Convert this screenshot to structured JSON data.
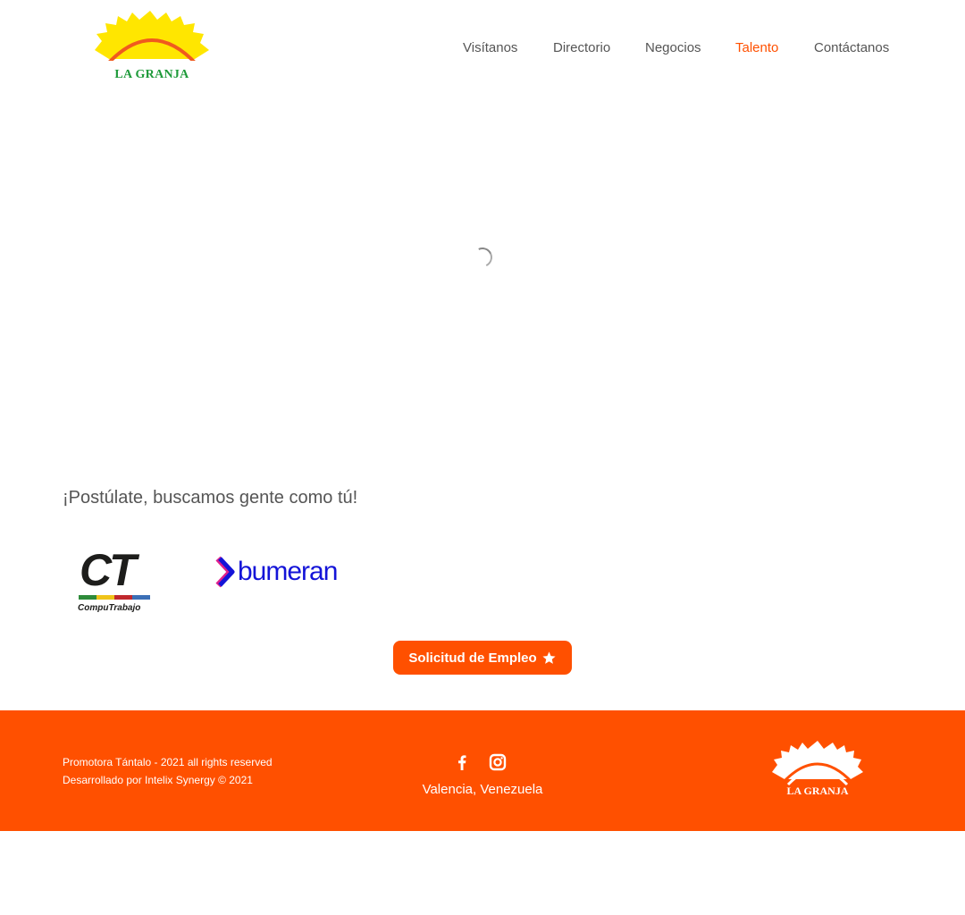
{
  "header": {
    "logo_text": "LA GRANJA",
    "nav": [
      {
        "label": "Visítanos",
        "active": false
      },
      {
        "label": "Directorio",
        "active": false
      },
      {
        "label": "Negocios",
        "active": false
      },
      {
        "label": "Talento",
        "active": true
      },
      {
        "label": "Contáctanos",
        "active": false
      }
    ]
  },
  "main": {
    "headline": "¡Postúlate, buscamos gente como tú!",
    "partners": {
      "computrabajo": {
        "mark": "CT",
        "name": "CompuTrabajo"
      },
      "bumeran": {
        "name": "bumeran"
      }
    },
    "apply_button": {
      "label": "Solicitud de Empleo",
      "icon": "star-icon"
    }
  },
  "footer": {
    "copyright": "Promotora Tántalo - 2021 all rights reserved",
    "developer": "Desarrollado por Intelix Synergy © 2021",
    "social": [
      "facebook-icon",
      "instagram-icon"
    ],
    "location": "Valencia, Venezuela",
    "logo_text": "LA GRANJA"
  },
  "colors": {
    "accent": "#ff5000",
    "nav_text": "#555555",
    "logo_sun": "#ffe600",
    "logo_arc": "#f05a1e",
    "logo_text": "#1e9a3a",
    "bumeran_blue": "#1414d8"
  }
}
